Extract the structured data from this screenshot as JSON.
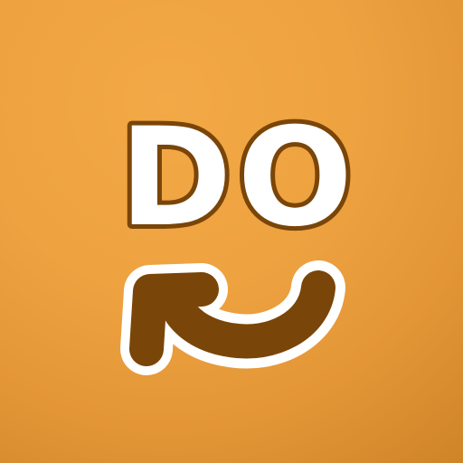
{
  "app": {
    "wordmark": "DO",
    "icon": "undo-arrow-icon"
  },
  "colors": {
    "background": "#eea240",
    "letter_fill": "#ffffff",
    "outline": "#7a4508",
    "arrow_fill": "#7a4508",
    "arrow_border": "#ffffff"
  }
}
